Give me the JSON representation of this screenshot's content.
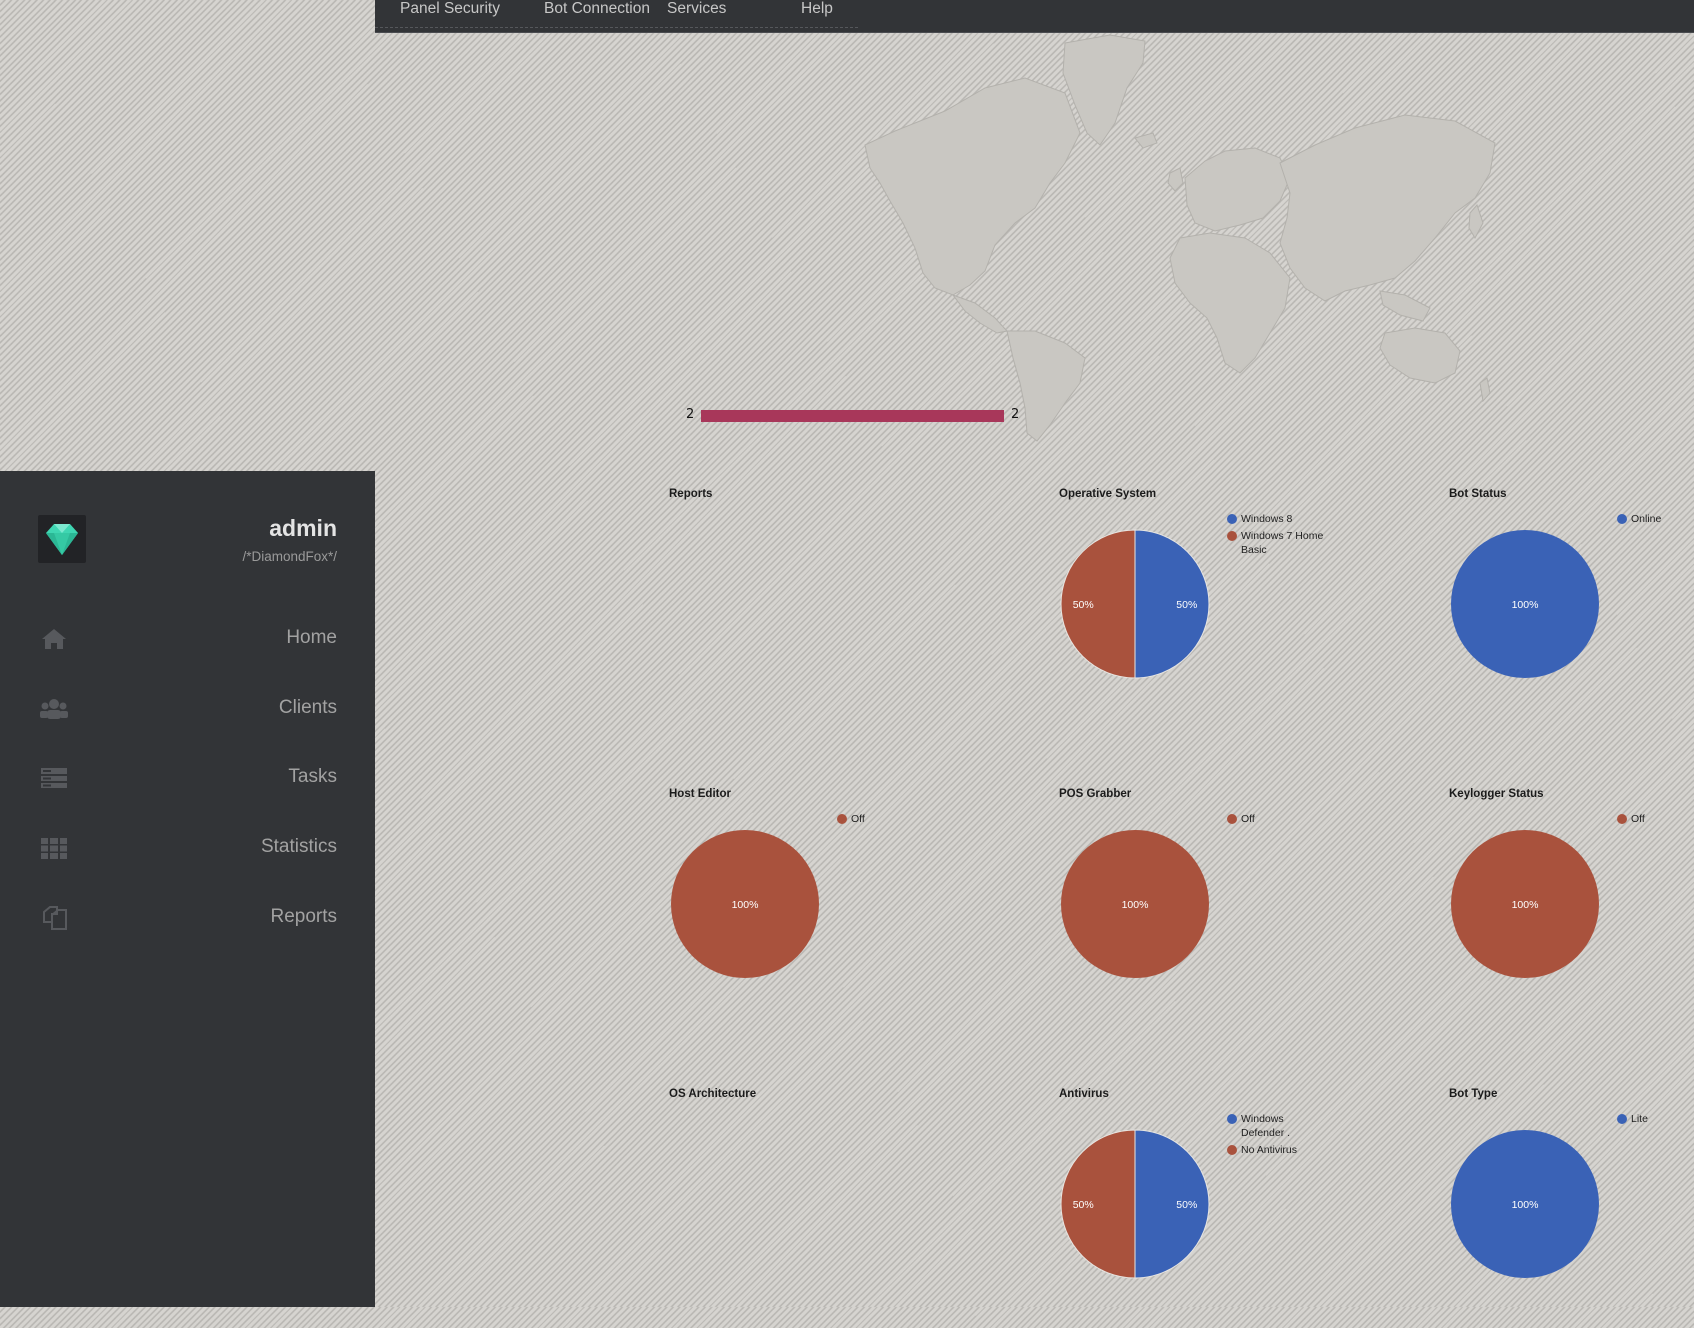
{
  "topnav": {
    "items": [
      "Panel Security",
      "Bot Connection",
      "Services",
      "Help"
    ]
  },
  "sidebar": {
    "user": "admin",
    "subtitle": "/*DiamondFox*/",
    "items": [
      {
        "label": "Home",
        "icon": "home-icon"
      },
      {
        "label": "Clients",
        "icon": "users-icon"
      },
      {
        "label": "Tasks",
        "icon": "tasks-icon"
      },
      {
        "label": "Statistics",
        "icon": "grid-icon"
      },
      {
        "label": "Reports",
        "icon": "copy-icon"
      }
    ]
  },
  "map": {
    "legend_min": "2",
    "legend_max": "2",
    "legend_color": "#a8375a"
  },
  "colors": {
    "blue": "#3a62b6",
    "red": "#a9523d"
  },
  "chart_data": [
    {
      "id": "reports",
      "title": "Reports",
      "type": "pie",
      "slices": []
    },
    {
      "id": "os",
      "title": "Operative System",
      "type": "pie",
      "slices": [
        {
          "label": "Windows 8",
          "value": 50,
          "percent": "50%",
          "color": "#3a62b6"
        },
        {
          "label": "Windows 7 Home Basic",
          "value": 50,
          "percent": "50%",
          "color": "#a9523d"
        }
      ]
    },
    {
      "id": "bot-status",
      "title": "Bot Status",
      "type": "pie",
      "slices": [
        {
          "label": "Online",
          "value": 100,
          "percent": "100%",
          "color": "#3a62b6"
        }
      ]
    },
    {
      "id": "host-editor",
      "title": "Host Editor",
      "type": "pie",
      "slices": [
        {
          "label": "Off",
          "value": 100,
          "percent": "100%",
          "color": "#a9523d"
        }
      ]
    },
    {
      "id": "pos-grabber",
      "title": "POS Grabber",
      "type": "pie",
      "slices": [
        {
          "label": "Off",
          "value": 100,
          "percent": "100%",
          "color": "#a9523d"
        }
      ]
    },
    {
      "id": "keylogger",
      "title": "Keylogger Status",
      "type": "pie",
      "slices": [
        {
          "label": "Off",
          "value": 100,
          "percent": "100%",
          "color": "#a9523d"
        }
      ]
    },
    {
      "id": "os-arch",
      "title": "OS Architecture",
      "type": "pie",
      "slices": []
    },
    {
      "id": "antivirus",
      "title": "Antivirus",
      "type": "pie",
      "slices": [
        {
          "label": "Windows Defender .",
          "value": 50,
          "percent": "50%",
          "color": "#3a62b6"
        },
        {
          "label": "No Antivirus",
          "value": 50,
          "percent": "50%",
          "color": "#a9523d"
        }
      ]
    },
    {
      "id": "bot-type",
      "title": "Bot Type",
      "type": "pie",
      "slices": [
        {
          "label": "Lite",
          "value": 100,
          "percent": "100%",
          "color": "#3a62b6"
        }
      ]
    }
  ]
}
